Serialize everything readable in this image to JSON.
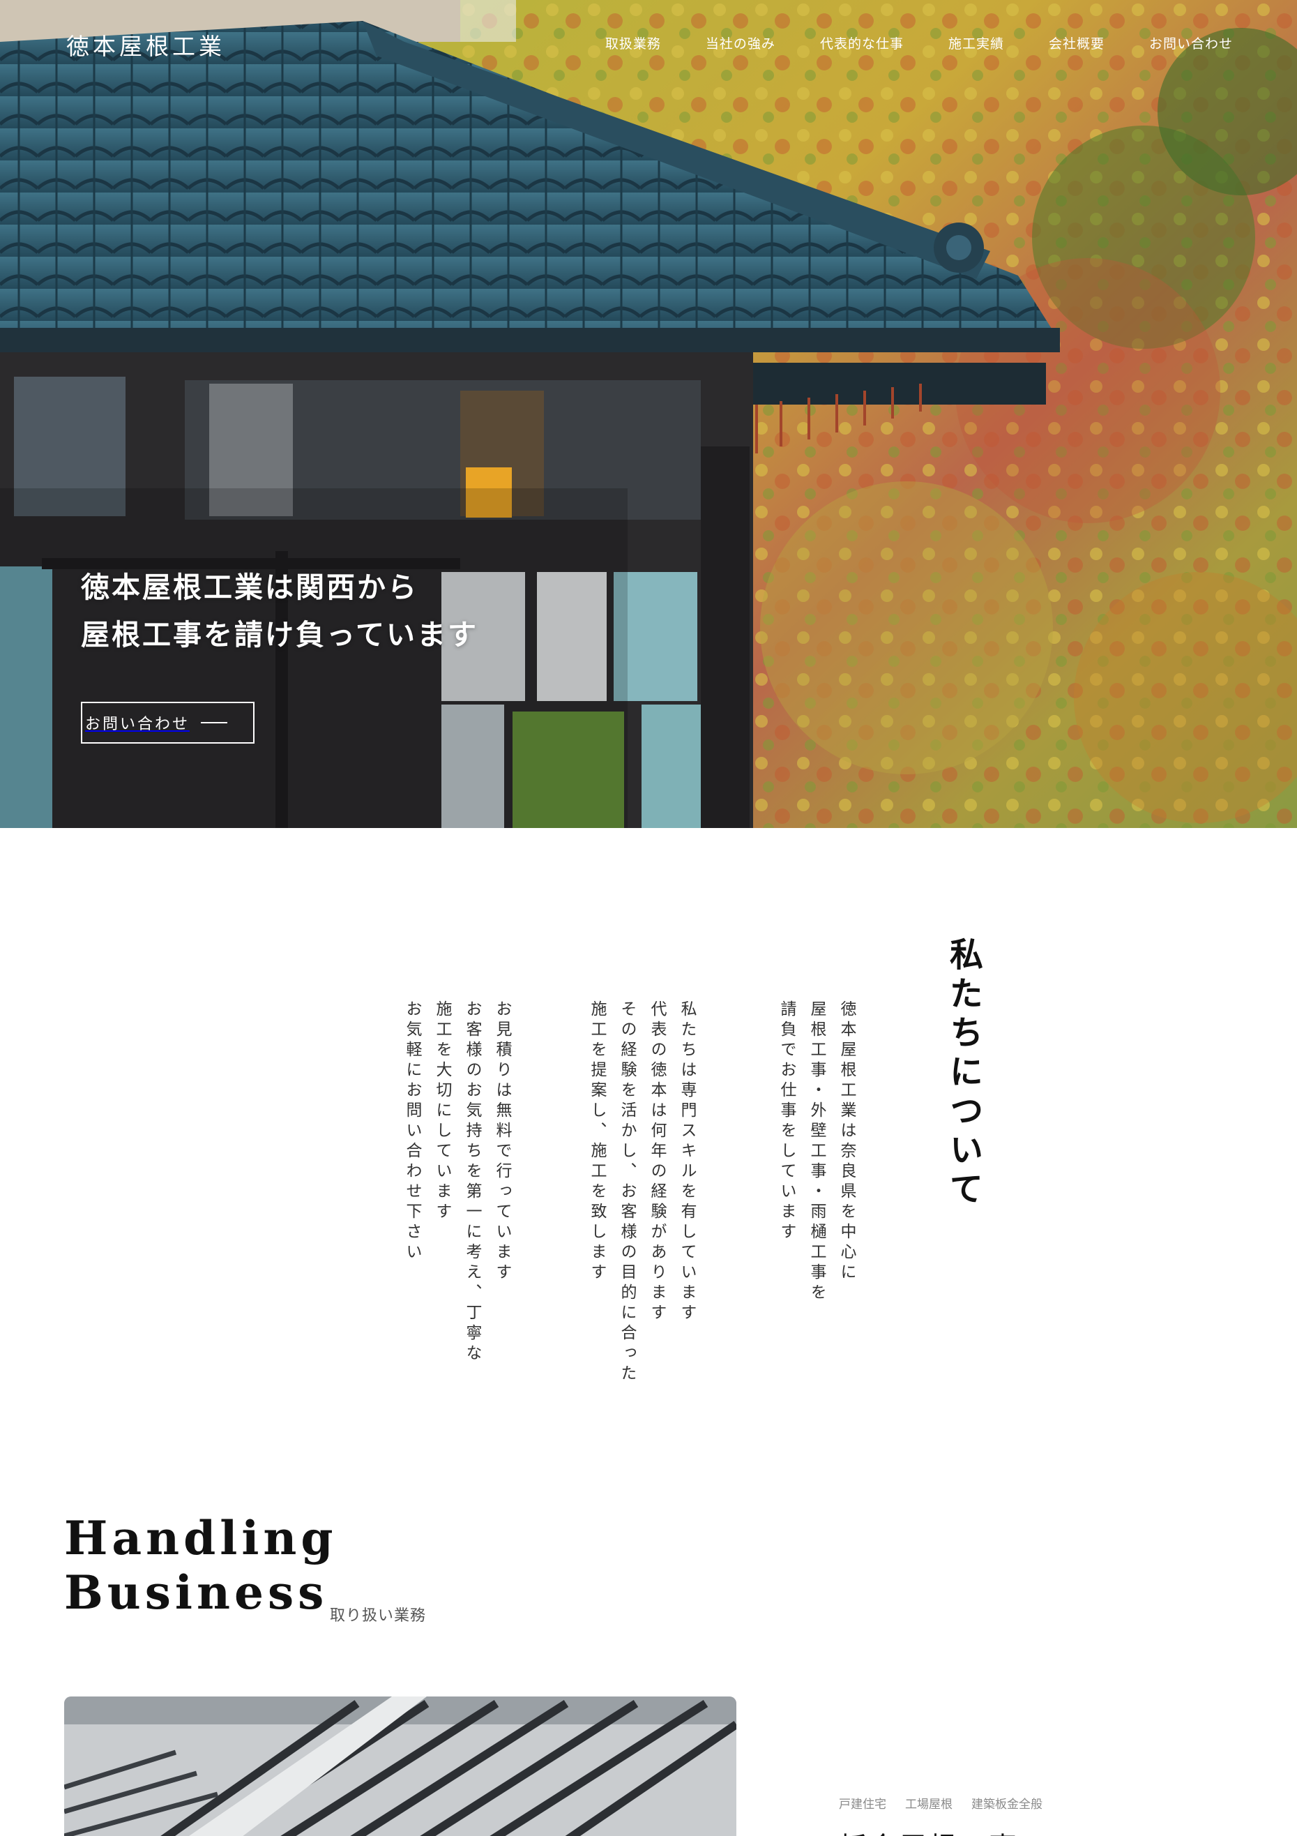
{
  "header": {
    "logo": "徳本屋根工業",
    "nav": [
      "取扱業務",
      "当社の強み",
      "代表的な仕事",
      "施工実績",
      "会社概要",
      "お問い合わせ"
    ]
  },
  "hero": {
    "lines": [
      "徳本屋根工業は関西から",
      "屋根工事を請け負っています"
    ],
    "cta_label": "お問い合わせ"
  },
  "about": {
    "heading": "私たちについて",
    "columns": [
      "徳本屋根工業は奈良県を中心に",
      "屋根工事・外壁工事・雨樋工事を",
      "請負でお仕事をしています",
      "私たちは専門スキルを有しています",
      "代表の徳本は何年の経験があります",
      "その経験を活かし、お客様の目的に合った",
      "施工を提案し、施工を致します",
      "お見積りは無料で行っています",
      "お客様のお気持ちを第一に考え、丁寧な",
      "施工を大切にしています",
      "お気軽にお問い合わせ下さい"
    ]
  },
  "business": {
    "title_line1": "Handling",
    "title_line2": "Business",
    "subtitle": "取り扱い業務",
    "tags": [
      "戸建住宅",
      "工場屋根",
      "建築板金全般"
    ],
    "item_title": "板金屋根工事"
  },
  "colors": {
    "roof_tile": "#2f5f73",
    "foliage_yellow": "#c9b23a",
    "foliage_red": "#b9674a",
    "text_dark": "#111111"
  }
}
